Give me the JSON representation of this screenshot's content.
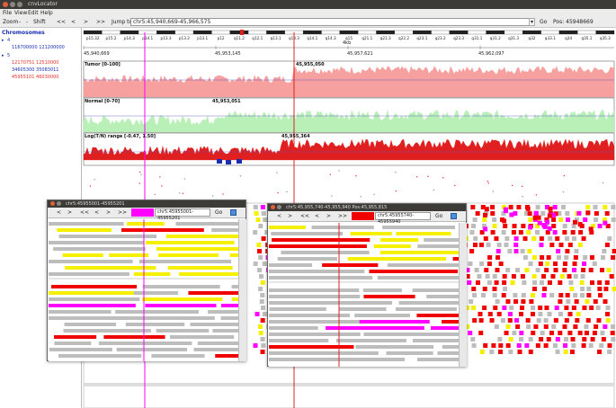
{
  "window": {
    "title": "cnvLocator"
  },
  "menu": [
    "File",
    "View",
    "Edit",
    "Help"
  ],
  "toolbar": {
    "zoom_label": "Zoom",
    "shift_label": "Shift",
    "nav": [
      "<<",
      "<",
      ">",
      ">>"
    ],
    "jump_label": "Jump to:",
    "jump_value": "chr5:45,940,669-45,966,575",
    "go": "Go",
    "pos": "Pos: 45948669"
  },
  "sidebar": {
    "title": "Chromosomes",
    "items": [
      {
        "label": "4",
        "color": "#1a2fb0"
      },
      {
        "label": "116700000 121200000",
        "color": "#1a2fb0"
      },
      {
        "label": "5",
        "color": "#1a2fb0"
      },
      {
        "label": "12170751 12510000",
        "color": "#e0302a"
      },
      {
        "label": "34605300 35083011",
        "color": "#1a2fb0"
      },
      {
        "label": "45955101 46030000",
        "color": "#e0302a"
      }
    ]
  },
  "ideogram": {
    "bands": [
      "p15.32",
      "p15.2",
      "p14.3",
      "p14.1",
      "p13.3",
      "p13.2",
      "p13.1",
      "p12",
      "q11.2",
      "q12.1",
      "q13.1",
      "q13.3",
      "q14.1",
      "q14.3",
      "q15",
      "q21.1",
      "q21.3",
      "q22.2",
      "q23.1",
      "q23.2",
      "q23.3",
      "q31.1",
      "q31.2",
      "q31.3",
      "q32",
      "q33.1",
      "q34",
      "q35.1",
      "q35.3"
    ],
    "unit": "4kb",
    "positions": [
      "45,940,669",
      "45,953,145",
      "45,957,621",
      "45,962,097"
    ]
  },
  "tracks": {
    "tumor": {
      "label": "Tumor [0-100]",
      "marker": "45,955,050"
    },
    "normal": {
      "label": "Normal [0-70]",
      "marker": "45,953,051"
    },
    "log": {
      "label": "Log(T/N) range [-0.47, 1.50]",
      "marker": "45,955,364"
    }
  },
  "popup1": {
    "title": "chr5:45955001-45955201",
    "nav": [
      "<",
      ">",
      "<<",
      "<",
      ">",
      ">>"
    ],
    "field": "chr5:45955001-45955201",
    "go": "Go"
  },
  "popup2": {
    "title": "chr5:45,955,740-45,955,940    Pos:45,955,815",
    "nav": [
      "<",
      ">",
      "<<",
      "<",
      ">",
      ">>"
    ],
    "field": "chr5:45955740-45955940",
    "go": "Go"
  },
  "colors": {
    "tumor": "#f7a0a0",
    "normal": "#b8f0b8",
    "log": "#e02020",
    "read_gray": "#bdbdbd",
    "read_yellow": "#f4f000",
    "read_red": "#f00000",
    "read_magenta": "#ff00ff"
  }
}
